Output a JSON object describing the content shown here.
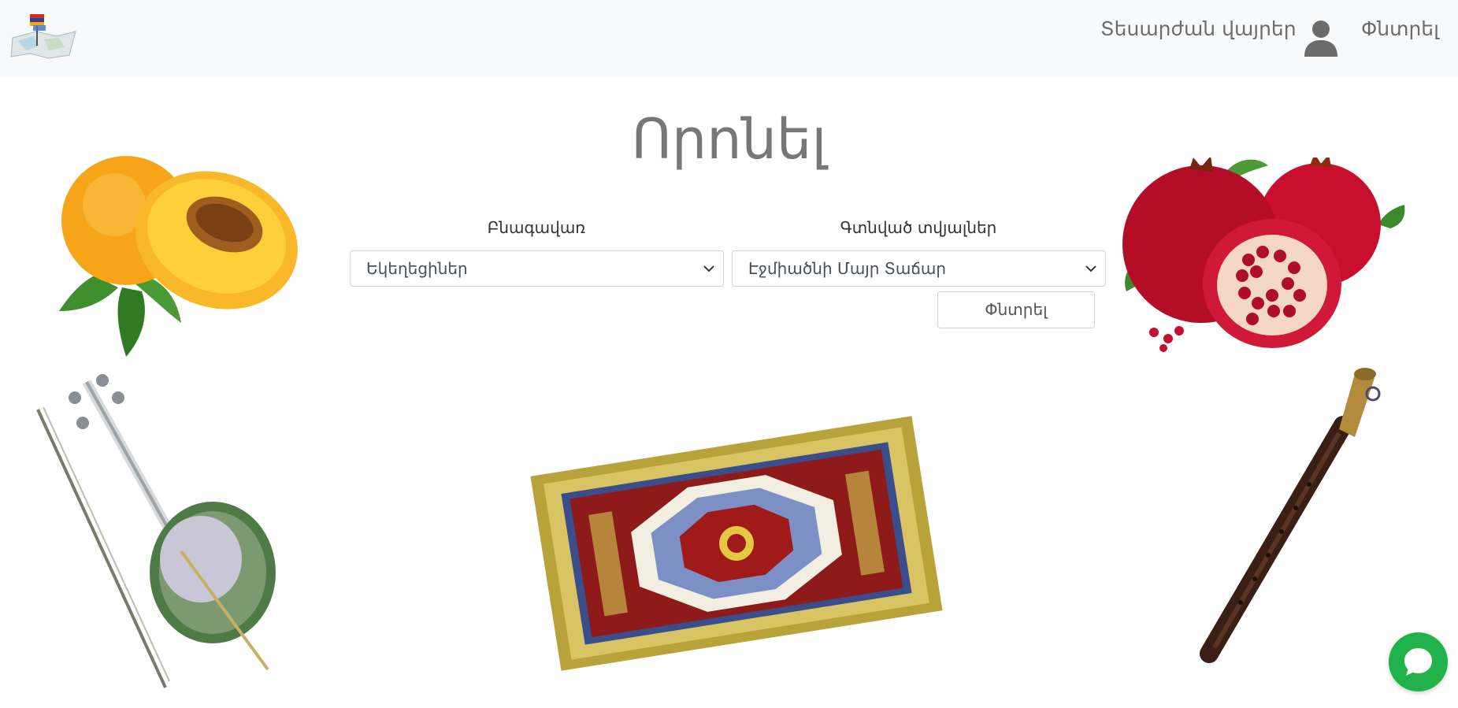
{
  "navbar": {
    "logo": "armenia-map-flag-logo",
    "links": {
      "sights": "Տեսարժան վայրեր",
      "search": "Փնտրել"
    },
    "user_icon": "user-icon"
  },
  "main": {
    "title": "Որոնել",
    "region": {
      "label": "Բնագավառ",
      "selected": "Եկեղեցիներ"
    },
    "data": {
      "label": "Գտնված տվյալներ",
      "selected": "Էջմիածնի Մայր Տաճար"
    },
    "search_button": "Փնտրել"
  },
  "images": [
    "apricot-image",
    "pomegranate-image",
    "kamancha-image",
    "carpet-image",
    "duduk-image"
  ],
  "chat": {
    "icon": "chat-bubble-icon",
    "color": "#21b24b"
  },
  "colors": {
    "navbar_bg": "#f8f9fa",
    "title": "#777777"
  }
}
